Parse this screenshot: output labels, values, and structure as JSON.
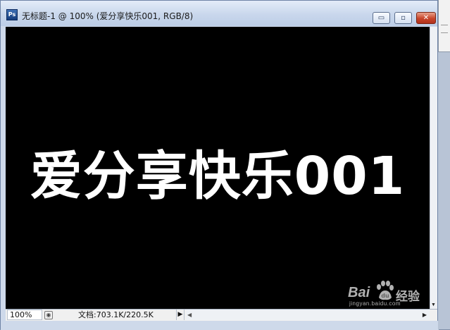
{
  "window": {
    "app_icon_label": "Ps",
    "title": "无标题-1 @ 100% (爱分享快乐001, RGB/8)",
    "controls": {
      "minimize": "▭",
      "maximize": "▫",
      "close": "✕"
    }
  },
  "canvas": {
    "background": "#000000",
    "text": "爱分享快乐001",
    "text_color": "#ffffff"
  },
  "statusbar": {
    "zoom": "100%",
    "doc_info": "文档:703.1K/220.5K",
    "menu_arrow": "▶",
    "scroll_left": "◀",
    "scroll_right": "▶"
  },
  "vscroll": {
    "down_arrow": "▼"
  },
  "watermark": {
    "bai": "Bai",
    "du_icon": "paw-icon",
    "jingyan": "经验",
    "url": "jingyan.baidu.com"
  },
  "colors": {
    "titlebar": "#c9d7ec",
    "close_button": "#c8452a",
    "canvas": "#000000"
  }
}
